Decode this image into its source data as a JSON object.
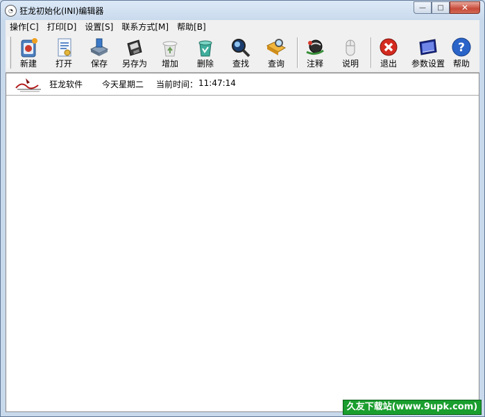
{
  "window": {
    "title": "狂龙初始化(INI)编辑器"
  },
  "caption": {
    "minimize": "—",
    "maximize": "□",
    "close": "✕"
  },
  "menu": [
    {
      "label": "操作[C]"
    },
    {
      "label": "打印[D]"
    },
    {
      "label": "设置[S]"
    },
    {
      "label": "联系方式[M]"
    },
    {
      "label": "帮助[B]"
    }
  ],
  "toolbar": {
    "buttons": [
      {
        "label": "新建",
        "icon": "new-file-icon"
      },
      {
        "label": "打开",
        "icon": "open-file-icon"
      },
      {
        "label": "保存",
        "icon": "save-disk-icon"
      },
      {
        "label": "另存为",
        "icon": "save-as-icon"
      },
      {
        "label": "增加",
        "icon": "add-icon"
      },
      {
        "label": "删除",
        "icon": "recycle-bin-icon"
      },
      {
        "label": "查找",
        "icon": "magnifier-icon"
      },
      {
        "label": "查询",
        "icon": "query-folder-icon"
      },
      {
        "label": "注释",
        "icon": "comment-globe-icon"
      },
      {
        "label": "说明",
        "icon": "mouse-icon"
      },
      {
        "label": "退出",
        "icon": "exit-x-icon"
      },
      {
        "label": "参数设置",
        "icon": "monitor-settings-icon"
      },
      {
        "label": "帮助",
        "icon": "help-icon"
      }
    ]
  },
  "info": {
    "brand": "狂龙软件",
    "weekday": "今天星期二",
    "time_label": "当前时间：",
    "time": "11:47:14"
  },
  "watermark": {
    "text": "久友下载站(www.9upk.com)"
  },
  "colors": {
    "accent_red": "#d42a1f",
    "help_blue": "#2a64c8",
    "watermark_green": "#1a9e2e"
  }
}
